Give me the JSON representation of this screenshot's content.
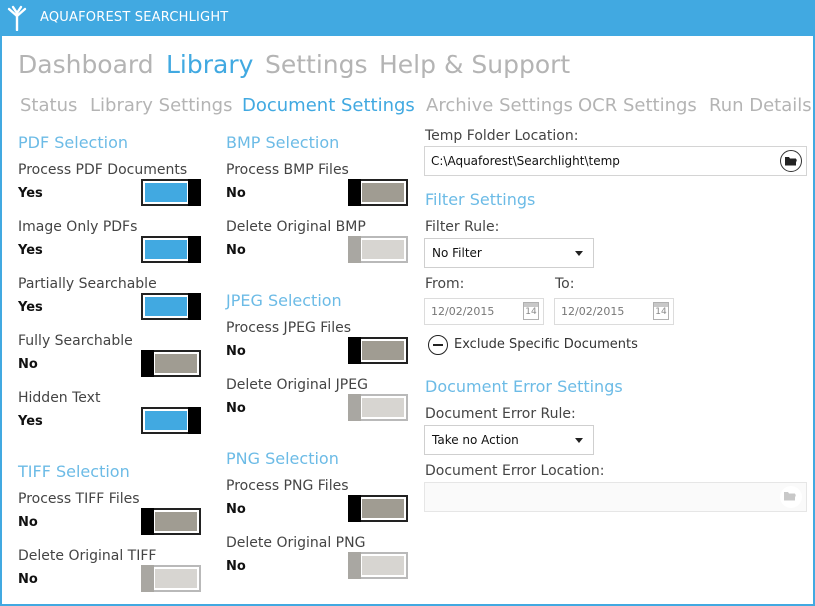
{
  "app": {
    "title": "AQUAFOREST SEARCHLIGHT",
    "logo_icon": "tree-logo-icon"
  },
  "main_nav": [
    {
      "label": "Dashboard",
      "active": false
    },
    {
      "label": "Library",
      "active": true
    },
    {
      "label": "Settings",
      "active": false
    },
    {
      "label": "Help & Support",
      "active": false
    }
  ],
  "sub_nav": [
    {
      "label": "Status",
      "active": false
    },
    {
      "label": "Library Settings",
      "active": false
    },
    {
      "label": "Document Settings",
      "active": true
    },
    {
      "label": "Archive Settings",
      "active": false
    },
    {
      "label": "OCR Settings",
      "active": false
    },
    {
      "label": "Run Details",
      "active": false
    }
  ],
  "pdf": {
    "title": "PDF Selection",
    "options": [
      {
        "label": "Process PDF Documents",
        "value": "Yes",
        "state": "on"
      },
      {
        "label": "Image Only PDFs",
        "value": "Yes",
        "state": "on"
      },
      {
        "label": "Partially Searchable",
        "value": "Yes",
        "state": "on"
      },
      {
        "label": "Fully Searchable",
        "value": "No",
        "state": "off"
      },
      {
        "label": "Hidden Text",
        "value": "Yes",
        "state": "on"
      }
    ]
  },
  "tiff": {
    "title": "TIFF Selection",
    "options": [
      {
        "label": "Process TIFF Files",
        "value": "No",
        "state": "off"
      },
      {
        "label": "Delete Original TIFF",
        "value": "No",
        "state": "disabled"
      }
    ]
  },
  "bmp": {
    "title": "BMP Selection",
    "options": [
      {
        "label": "Process BMP Files",
        "value": "No",
        "state": "off"
      },
      {
        "label": "Delete Original BMP",
        "value": "No",
        "state": "disabled"
      }
    ]
  },
  "jpeg": {
    "title": "JPEG Selection",
    "options": [
      {
        "label": "Process JPEG Files",
        "value": "No",
        "state": "off"
      },
      {
        "label": "Delete Original JPEG",
        "value": "No",
        "state": "disabled"
      }
    ]
  },
  "png": {
    "title": "PNG Selection",
    "options": [
      {
        "label": "Process PNG Files",
        "value": "No",
        "state": "off"
      },
      {
        "label": "Delete Original PNG",
        "value": "No",
        "state": "disabled"
      }
    ]
  },
  "temp_folder": {
    "label": "Temp Folder Location:",
    "value": "C:\\Aquaforest\\Searchlight\\temp",
    "browse_icon": "folder-open-icon"
  },
  "filter": {
    "title": "Filter Settings",
    "rule_label": "Filter Rule:",
    "rule_value": "No Filter",
    "from_label": "From:",
    "from_value": "12/02/2015",
    "to_label": "To:",
    "to_value": "12/02/2015",
    "calendar_day": "14",
    "exclude_label": "Exclude Specific Documents"
  },
  "doc_error": {
    "title": "Document Error Settings",
    "rule_label": "Document Error Rule:",
    "rule_value": "Take no Action",
    "location_label": "Document Error Location:",
    "location_value": ""
  },
  "colors": {
    "accent": "#41a9e1",
    "toggle_off": "#a09c92",
    "inactive_text": "#b4b4b4"
  }
}
